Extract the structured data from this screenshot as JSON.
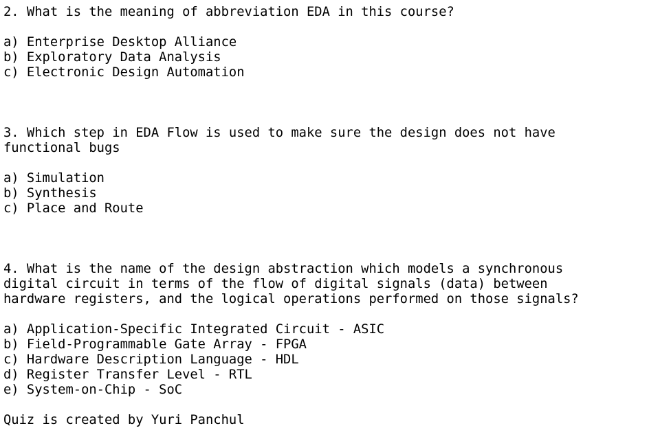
{
  "document": {
    "type": "quiz-text-page",
    "background_color": "#ffffff",
    "text_color": "#000000",
    "blocks": [
      {
        "kind": "question",
        "name": "question-2",
        "lines": [
          "2. What is the meaning of abbreviation EDA in this course?"
        ]
      },
      {
        "kind": "spacer",
        "name": "spacer-after-question-2",
        "lines": [
          ""
        ]
      },
      {
        "kind": "options",
        "name": "question-2-options",
        "lines": [
          "a) Enterprise Desktop Alliance",
          "b) Exploratory Data Analysis",
          "c) Electronic Design Automation"
        ]
      },
      {
        "kind": "spacer",
        "name": "spacer-after-question-2-options",
        "lines": [
          "",
          "",
          ""
        ]
      },
      {
        "kind": "question",
        "name": "question-3",
        "lines": [
          "3. Which step in EDA Flow is used to make sure the design does not have",
          "functional bugs"
        ]
      },
      {
        "kind": "spacer",
        "name": "spacer-after-question-3",
        "lines": [
          ""
        ]
      },
      {
        "kind": "options",
        "name": "question-3-options",
        "lines": [
          "a) Simulation",
          "b) Synthesis",
          "c) Place and Route"
        ]
      },
      {
        "kind": "spacer",
        "name": "spacer-after-question-3-options",
        "lines": [
          "",
          "",
          ""
        ]
      },
      {
        "kind": "question",
        "name": "question-4",
        "lines": [
          "4. What is the name of the design abstraction which models a synchronous",
          "digital circuit in terms of the flow of digital signals (data) between",
          "hardware registers, and the logical operations performed on those signals?"
        ]
      },
      {
        "kind": "spacer",
        "name": "spacer-after-question-4",
        "lines": [
          ""
        ]
      },
      {
        "kind": "options",
        "name": "question-4-options",
        "lines": [
          "a) Application-Specific Integrated Circuit - ASIC",
          "b) Field-Programmable Gate Array - FPGA",
          "c) Hardware Description Language - HDL",
          "d) Register Transfer Level - RTL",
          "e) System-on-Chip - SoC"
        ]
      },
      {
        "kind": "spacer",
        "name": "spacer-before-footer",
        "lines": [
          ""
        ]
      },
      {
        "kind": "footer",
        "name": "quiz-credit",
        "lines": [
          "Quiz is created by Yuri Panchul"
        ]
      }
    ]
  }
}
